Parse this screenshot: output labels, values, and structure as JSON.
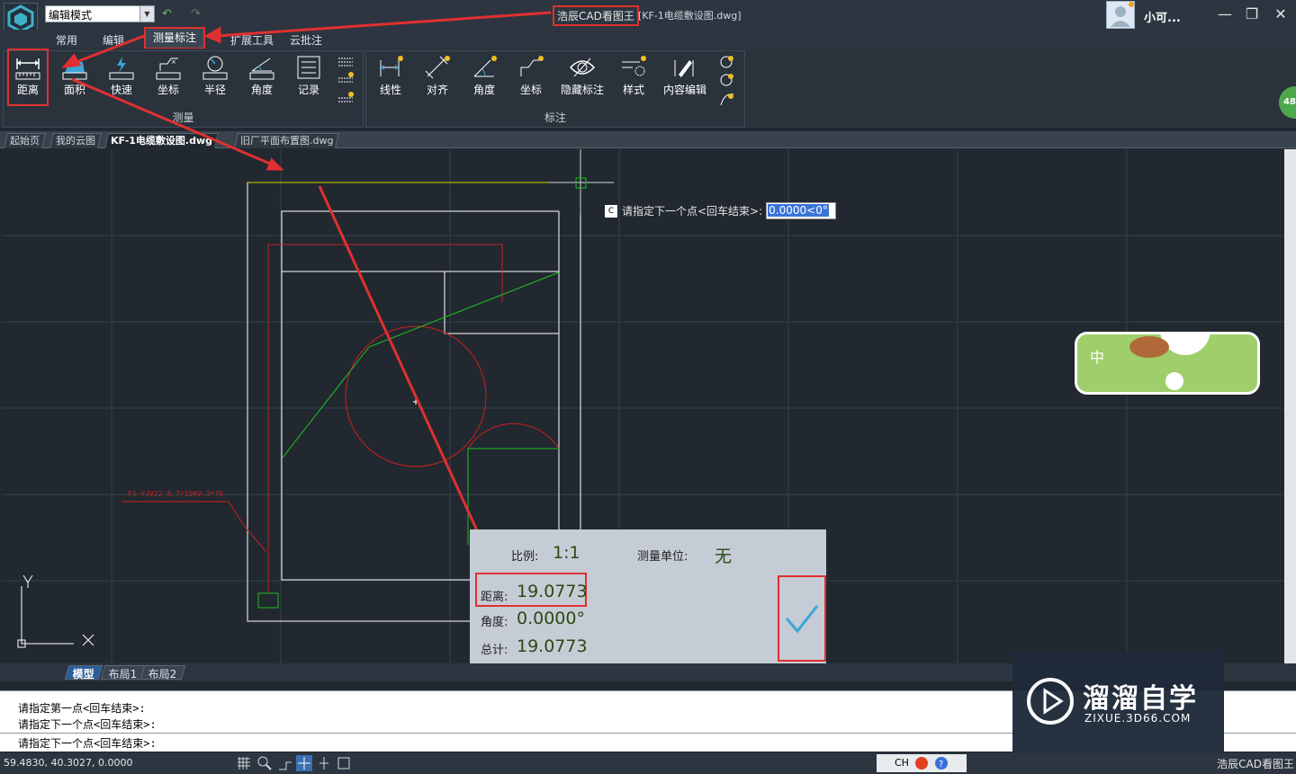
{
  "app": {
    "name": "浩辰CAD看图王",
    "document_title": "[KF-1电缆敷设图.dwg]",
    "mode": "编辑模式",
    "user": "小可..."
  },
  "menus": [
    "常用",
    "编辑",
    "测量标注",
    "扩展工具",
    "云批注"
  ],
  "ribbon": {
    "measure": {
      "label": "测量",
      "tools": [
        "距离",
        "面积",
        "快速",
        "坐标",
        "半径",
        "角度",
        "记录"
      ]
    },
    "annotate": {
      "label": "标注",
      "tools": [
        "线性",
        "对齐",
        "角度",
        "坐标",
        "隐藏标注",
        "样式",
        "内容编辑"
      ]
    }
  },
  "doc_tabs": [
    "起始页",
    "我的云图",
    "KF-1电缆敷设图.dwg",
    "旧厂平面布置图.dwg"
  ],
  "prompt": {
    "text": "请指定下一个点<回车结束>:",
    "value": "0.0000<0°"
  },
  "result": {
    "scale_label": "比例:",
    "scale": "1:1",
    "unit_label": "测量单位:",
    "unit": "无",
    "distance_label": "距离:",
    "distance": "19.0773",
    "angle_label": "角度:",
    "angle": "0.0000°",
    "total_label": "总计:",
    "total": "19.0773"
  },
  "cad_label": "FS-YJV22-8.7/15KV-3*70",
  "layout_tabs": [
    "模型",
    "布局1",
    "布局2"
  ],
  "command_lines": [
    "请指定第一点<回车结束>:",
    "请指定下一个点<回车结束>:"
  ],
  "command_input": "请指定下一个点<回车结束>:",
  "status": {
    "coords": "59.4830, 40.3027, 0.0000",
    "ime": "CH",
    "brand": "浩辰CAD看图王"
  },
  "badge": "48",
  "watermark": {
    "title": "溜溜自学",
    "url": "ZIXUE.3D66.COM"
  },
  "sticker_text": "中",
  "colors": {
    "highlight": "#e03030",
    "canvas": "#212830",
    "result_bg": "#c5ccd6"
  }
}
